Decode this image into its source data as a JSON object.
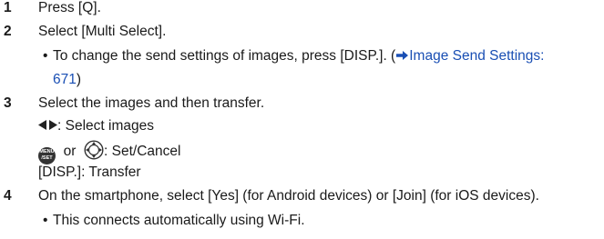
{
  "steps": [
    {
      "num": "1",
      "text": "Press [Q]."
    },
    {
      "num": "2",
      "text": "Select [Multi Select]."
    },
    {
      "num": "3",
      "text": "Select the images and then transfer."
    },
    {
      "num": "4",
      "text": "On the smartphone, select [Yes] (for Android devices) or [Join] (for iOS devices)."
    }
  ],
  "step2_bullet": {
    "prefix": "To change the send settings of images, press [DISP.]. (",
    "link": "Image Send Settings:",
    "link_page": "671",
    "suffix": ")"
  },
  "step3_items": {
    "select_label": ": Select images",
    "or_text": "or",
    "set_label": ": Set/Cancel",
    "transfer_line": "[DISP.]: Transfer"
  },
  "menu_button_text": {
    "line1": "MENU",
    "line2": "/SET"
  },
  "step4_bullet": "This connects automatically using Wi-Fi.",
  "bullet_symbol": "•",
  "icons": [
    "arrow-right-icon",
    "left-right-arrows-icon",
    "menu-set-button-icon",
    "control-dial-icon"
  ],
  "colors": {
    "link": "#1a4fb4",
    "text": "#1a1a1a"
  }
}
